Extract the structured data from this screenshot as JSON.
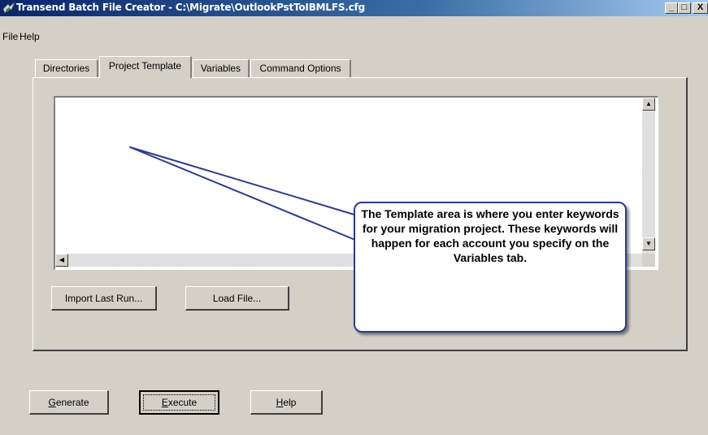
{
  "window": {
    "title": "Transend Batch File Creator - C:\\Migrate\\OutlookPstToIBMLFS.cfg",
    "minimize_glyph": "_",
    "maximize_glyph": "□",
    "close_glyph": "X",
    "icon": "transend-app-icon"
  },
  "menu": {
    "items": [
      "File",
      "Help"
    ]
  },
  "tabs": [
    {
      "label": "Directories",
      "active": false
    },
    {
      "label": "Project Template",
      "active": true
    },
    {
      "label": "Variables",
      "active": false
    },
    {
      "label": "Command Options",
      "active": false
    }
  ],
  "template_area": {
    "value": ""
  },
  "scrollbar": {
    "up": "▲",
    "down": "▼",
    "left": "◀"
  },
  "buttons": {
    "import_last_run": "Import Last Run...",
    "load_file": "Load File..."
  },
  "footer_buttons": [
    {
      "label": "Generate",
      "mnemonic": "G",
      "rest": "enerate"
    },
    {
      "label": "Execute",
      "mnemonic": "E",
      "rest": "xecute"
    },
    {
      "label": "Help",
      "mnemonic": "H",
      "rest": "elp"
    }
  ],
  "callout": {
    "text": "The Template area is where you enter keywords for your migration project. These keywords will happen for each account you specify on the Variables tab."
  },
  "colors": {
    "titlebar_start": "#0a246a",
    "titlebar_end": "#a6caf0",
    "callout_border": "#2b3a8f",
    "window_bg": "#d4d0c8"
  }
}
